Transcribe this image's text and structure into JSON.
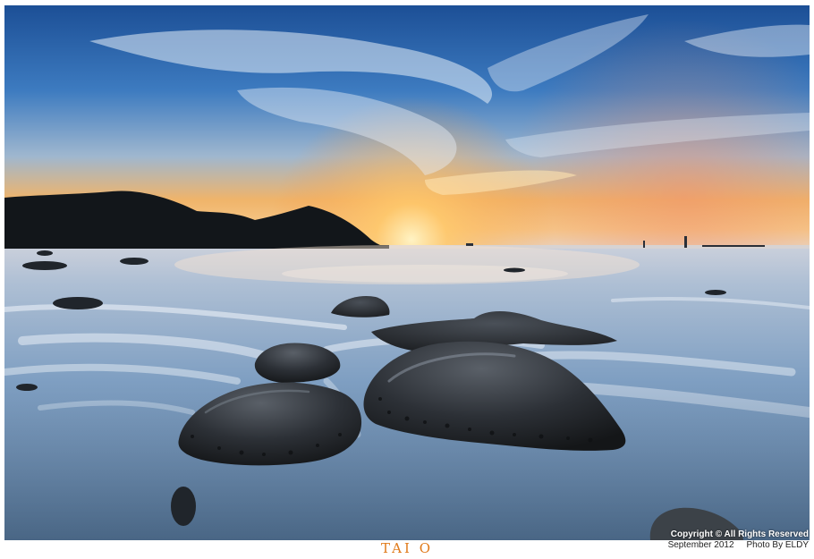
{
  "caption": {
    "title": "TAI O"
  },
  "credits": {
    "copyright": "Copyright © All Rights Reserved",
    "date": "September 2012",
    "photographer": "Photo By ELDY"
  },
  "colors": {
    "title": "#e07a1a",
    "sky_top": "#1f5fa8",
    "sunset_glow": "#f3a44c",
    "sea": "#8fb0cf"
  }
}
